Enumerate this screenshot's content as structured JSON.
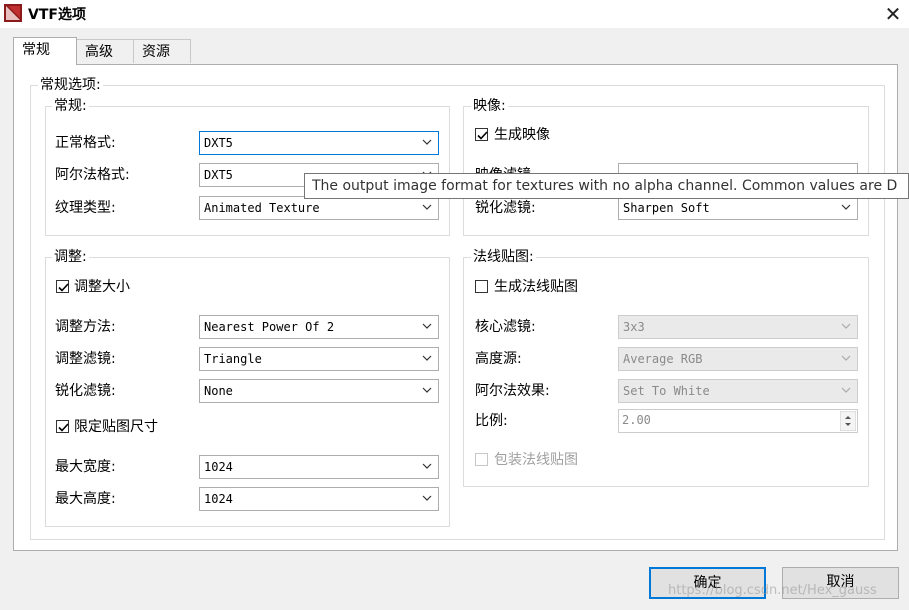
{
  "window": {
    "title": "VTF选项",
    "close_glyph": "✕"
  },
  "tabs": [
    {
      "label": "常规"
    },
    {
      "label": "高级"
    },
    {
      "label": "资源"
    }
  ],
  "general_options": {
    "legend": "常规选项:",
    "general": {
      "legend": "常规:",
      "normal_format": {
        "label": "正常格式:",
        "value": "DXT5"
      },
      "alpha_format": {
        "label": "阿尔法格式:",
        "value": "DXT5"
      },
      "texture_type": {
        "label": "纹理类型:",
        "value": "Animated Texture"
      }
    },
    "mipmaps": {
      "legend": "映像:",
      "generate": {
        "label": "生成映像",
        "checked": true
      },
      "mip_filter": {
        "label": "映像滤镜",
        "value": ""
      },
      "sharpen": {
        "label": "锐化滤镜:",
        "value": "Sharpen Soft"
      }
    },
    "resize": {
      "legend": "调整:",
      "resize_check": {
        "label": "调整大小",
        "checked": true
      },
      "method": {
        "label": "调整方法:",
        "value": "Nearest Power Of 2"
      },
      "filter": {
        "label": "调整滤镜:",
        "value": "Triangle"
      },
      "sharpen": {
        "label": "锐化滤镜:",
        "value": "None"
      },
      "clamp_check": {
        "label": "限定贴图尺寸",
        "checked": true
      },
      "max_width": {
        "label": "最大宽度:",
        "value": "1024"
      },
      "max_height": {
        "label": "最大高度:",
        "value": "1024"
      }
    },
    "normal_map": {
      "legend": "法线贴图:",
      "generate": {
        "label": "生成法线贴图",
        "checked": false
      },
      "kernel": {
        "label": "核心滤镜:",
        "value": "3x3"
      },
      "height_source": {
        "label": "高度源:",
        "value": "Average RGB"
      },
      "alpha_result": {
        "label": "阿尔法效果:",
        "value": "Set To White"
      },
      "scale": {
        "label": "比例:",
        "value": "2.00"
      },
      "wrap": {
        "label": "包装法线贴图",
        "checked": false
      }
    }
  },
  "tooltip": {
    "text": "The output image format for textures with no alpha channel. Common values are D"
  },
  "buttons": {
    "ok": "确定",
    "cancel": "取消"
  },
  "watermark": "https://blog.csdn.net/Hex_gauss"
}
